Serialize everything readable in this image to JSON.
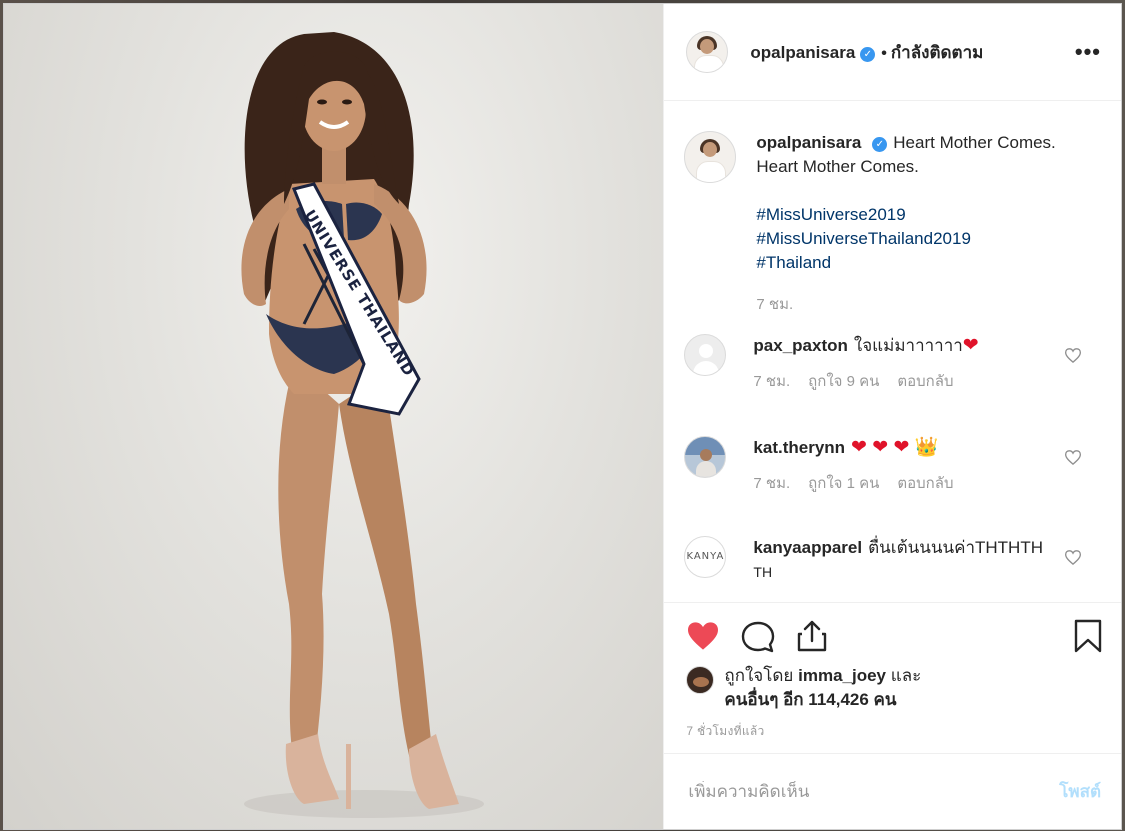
{
  "post": {
    "username": "opalpanisara",
    "following_label": "กำลังติดตาม",
    "more_label": "•••",
    "verified_mark": "✓",
    "caption": {
      "line1": "Heart Mother Comes.",
      "line2": "Heart Mother Comes.",
      "hashtags": [
        "#MissUniverse2019",
        "#MissUniverseThailand2019",
        "#Thailand"
      ],
      "time": "7 ชม."
    },
    "sash_text": "UNIVERSE THAILAND"
  },
  "comments": [
    {
      "username": "pax_paxton",
      "text": "ใจแม่มาาาาาา",
      "emoji": "❤",
      "time": "7 ชม.",
      "likes": "ถูกใจ 9 คน",
      "reply": "ตอบกลับ"
    },
    {
      "username": "kat.therynn",
      "text": "",
      "emoji": "❤ ❤ ❤ 👑",
      "time": "7 ชม.",
      "likes": "ถูกใจ 1 คน",
      "reply": "ตอบกลับ"
    },
    {
      "username": "kanyaapparel",
      "text": "ตื่นเต้นนนนค่าTHTHTH",
      "text2": "TH",
      "avatar_text": "KANYA"
    }
  ],
  "likes": {
    "prefix": "ถูกใจโดย",
    "user": "imma_joey",
    "and": "และ",
    "others": "คนอื่นๆ อีก 114,426 คน"
  },
  "time_ago": "7 ชั่วโมงที่แล้ว",
  "add_comment": {
    "placeholder": "เพิ่มความคิดเห็น",
    "post_label": "โพสต์"
  },
  "colors": {
    "like_red": "#ed4956",
    "link_blue": "#003569",
    "verified_blue": "#3897f0",
    "post_disabled": "#b2dffc"
  }
}
